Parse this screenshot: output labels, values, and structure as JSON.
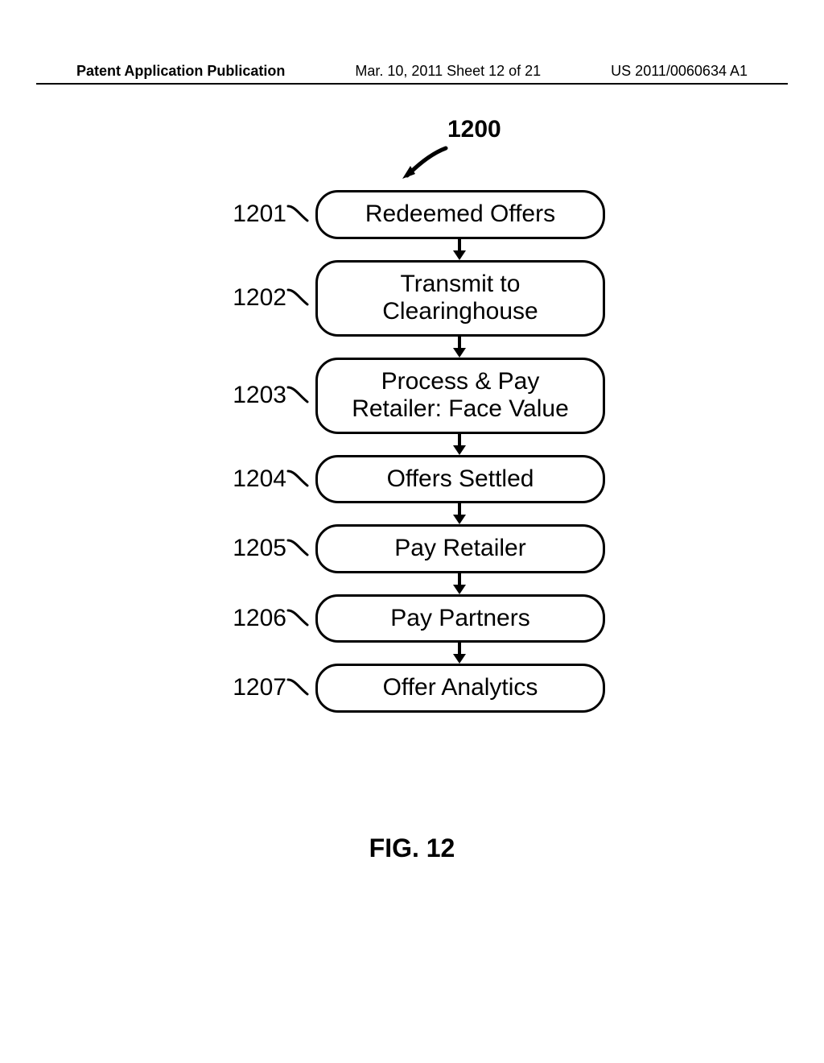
{
  "header": {
    "left": "Patent Application Publication",
    "mid": "Mar. 10, 2011  Sheet 12 of 21",
    "right": "US 2011/0060634 A1"
  },
  "figref": "1200",
  "steps": [
    {
      "num": "1201",
      "text": "Redeemed Offers"
    },
    {
      "num": "1202",
      "text": "Transmit to\nClearinghouse"
    },
    {
      "num": "1203",
      "text": "Process & Pay\nRetailer: Face Value"
    },
    {
      "num": "1204",
      "text": "Offers Settled"
    },
    {
      "num": "1205",
      "text": "Pay Retailer"
    },
    {
      "num": "1206",
      "text": "Pay Partners"
    },
    {
      "num": "1207",
      "text": "Offer Analytics"
    }
  ],
  "caption": "FIG. 12"
}
